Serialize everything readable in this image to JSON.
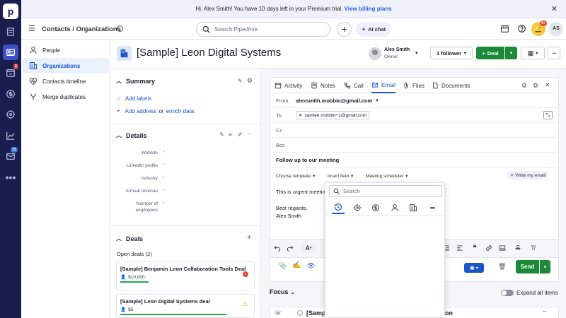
{
  "banner": {
    "text": "Hi, Alex Smith! You have 10 days left in your Premium trial.",
    "link": "View billing plans"
  },
  "leftnav": {
    "logo": "p",
    "badge_activities": "2",
    "badge_mail": "73"
  },
  "topbar": {
    "breadcrumb_parent": "Contacts",
    "breadcrumb_sep": "/",
    "breadcrumb_current": "Organizations",
    "search_placeholder": "Search Pipedrive",
    "ai_chat": "AI chat",
    "avatar": "AS",
    "notif_badge": "9+"
  },
  "subnav": {
    "items": [
      {
        "label": "People"
      },
      {
        "label": "Organizations"
      },
      {
        "label": "Contacts timeline"
      },
      {
        "label": "Merge duplicates"
      }
    ]
  },
  "org": {
    "title": "[Sample] Leon Digital Systems",
    "owner_name": "Alex Smith",
    "owner_role": "Owner",
    "follower": "1 follower",
    "deal_button": "Deal"
  },
  "summary": {
    "heading": "Summary",
    "add_labels": "Add labels",
    "add_address": "Add address",
    "or": "or",
    "enrich": "enrich data"
  },
  "details": {
    "heading": "Details",
    "fields": [
      {
        "label": "Website",
        "value": "-"
      },
      {
        "label": "LinkedIn profile",
        "value": "-"
      },
      {
        "label": "Industry",
        "value": "-"
      },
      {
        "label": "Annual revenue",
        "value": "-"
      },
      {
        "label": "Number of employees",
        "value": "-"
      }
    ]
  },
  "deals": {
    "heading": "Deals",
    "open_label": "Open deals (2)",
    "items": [
      {
        "title": "[Sample] Benjamin Leon Collaboration Tools Deal",
        "value": "$10,000"
      },
      {
        "title": "[Sample] Leon Digital Systems deal",
        "value": "$5"
      }
    ]
  },
  "tabs": [
    "Activity",
    "Notes",
    "Call",
    "Email",
    "Files",
    "Documents"
  ],
  "email": {
    "from_label": "From",
    "from": "alexsmith.mobbin@gmail.com",
    "to_label": "To",
    "to": "samlee.mobbin+1@gmail.com",
    "cc": "Cc",
    "bcc": "Bcc",
    "subject": "Follow up to our meeting",
    "choose_template": "Choose template",
    "insert_field": "Insert field",
    "meeting_scheduler": "Meeting scheduler",
    "write_my_email": "Write my email",
    "body_line1": "This is urgent meetin",
    "body_regards": "Best regards,",
    "body_name": "Alex Smith",
    "send": "Send"
  },
  "popup": {
    "search_placeholder": "Search"
  },
  "focus": {
    "label": "Focus",
    "expand": "Expand all items",
    "item_partial_left": "[Samp",
    "item_partial_right": "on"
  },
  "colors": {
    "nav_bg": "#1a1e4f",
    "accent_blue": "#1a56c9",
    "green": "#1d8a39"
  }
}
